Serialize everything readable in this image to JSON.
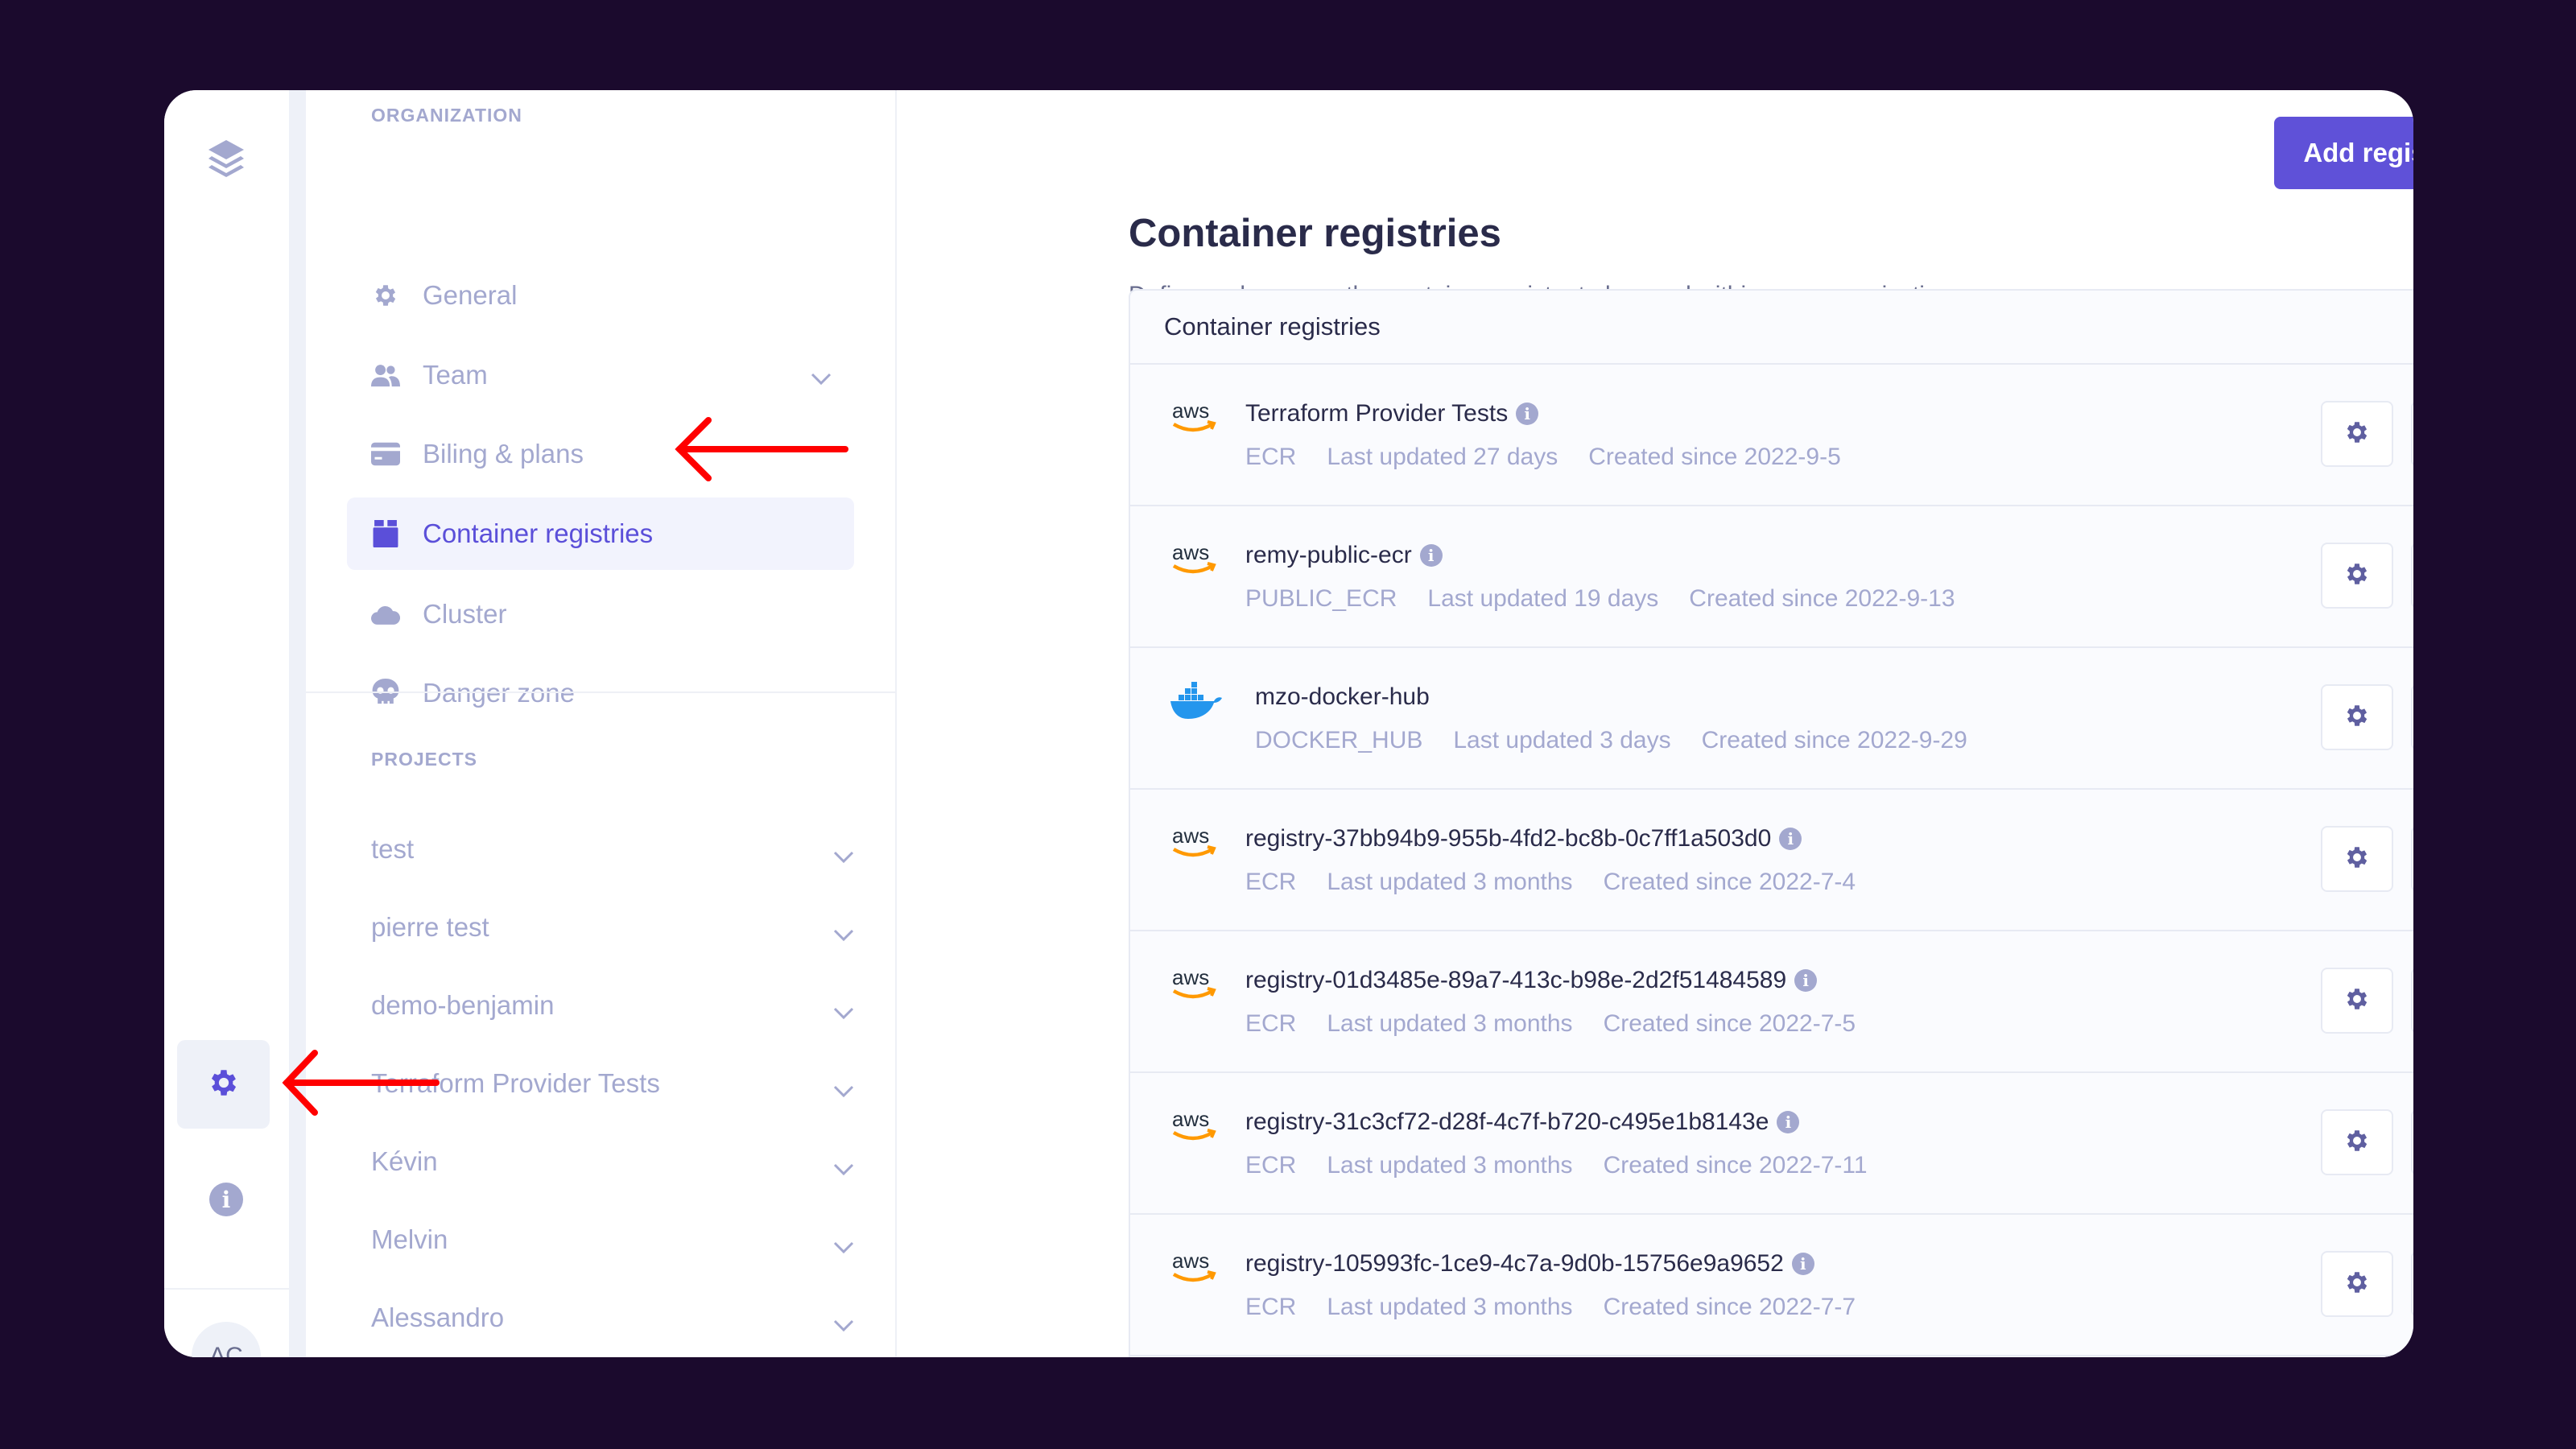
{
  "sidebar_rail": {
    "avatar_initials": "AC"
  },
  "nav": {
    "organization_label": "ORGANIZATION",
    "items": [
      {
        "label": "General",
        "icon": "gear-icon"
      },
      {
        "label": "Team",
        "icon": "users-icon",
        "expandable": true
      },
      {
        "label": "Biling & plans",
        "icon": "credit-card-icon"
      },
      {
        "label": "Container registries",
        "icon": "box-icon",
        "active": true
      },
      {
        "label": "Cluster",
        "icon": "cloud-icon"
      },
      {
        "label": "Danger zone",
        "icon": "skull-icon"
      }
    ],
    "projects_label": "PROJECTS",
    "projects": [
      "test",
      "pierre test",
      "demo-benjamin",
      "Terraform Provider Tests",
      "Kévin",
      "Melvin",
      "Alessandro"
    ]
  },
  "main": {
    "title": "Container registries",
    "subtitle": "Define and manage the container registry to be used within your organization.",
    "add_button": "Add registry",
    "panel_title": "Container registries",
    "registries": [
      {
        "name": "Terraform Provider Tests",
        "provider": "aws",
        "kind": "ECR",
        "updated": "Last updated 27 days",
        "created": "Created since 2022-9-5",
        "info": true
      },
      {
        "name": "remy-public-ecr",
        "provider": "aws",
        "kind": "PUBLIC_ECR",
        "updated": "Last updated 19 days",
        "created": "Created since 2022-9-13",
        "info": true
      },
      {
        "name": "mzo-docker-hub",
        "provider": "docker",
        "kind": "DOCKER_HUB",
        "updated": "Last updated 3 days",
        "created": "Created since 2022-9-29",
        "info": false
      },
      {
        "name": "registry-37bb94b9-955b-4fd2-bc8b-0c7ff1a503d0",
        "provider": "aws",
        "kind": "ECR",
        "updated": "Last updated 3 months",
        "created": "Created since 2022-7-4",
        "info": true
      },
      {
        "name": "registry-01d3485e-89a7-413c-b98e-2d2f51484589",
        "provider": "aws",
        "kind": "ECR",
        "updated": "Last updated 3 months",
        "created": "Created since 2022-7-5",
        "info": true
      },
      {
        "name": "registry-31c3cf72-d28f-4c7f-b720-c495e1b8143e",
        "provider": "aws",
        "kind": "ECR",
        "updated": "Last updated 3 months",
        "created": "Created since 2022-7-11",
        "info": true
      },
      {
        "name": "registry-105993fc-1ce9-4c7a-9d0b-15756e9a9652",
        "provider": "aws",
        "kind": "ECR",
        "updated": "Last updated 3 months",
        "created": "Created since 2022-7-7",
        "info": true
      }
    ]
  },
  "colors": {
    "accent": "#5f51d8",
    "muted": "#a3a8cf",
    "text": "#2a2b4a",
    "background": "#1b0a2d",
    "annotation_arrow": "#ff0000"
  }
}
